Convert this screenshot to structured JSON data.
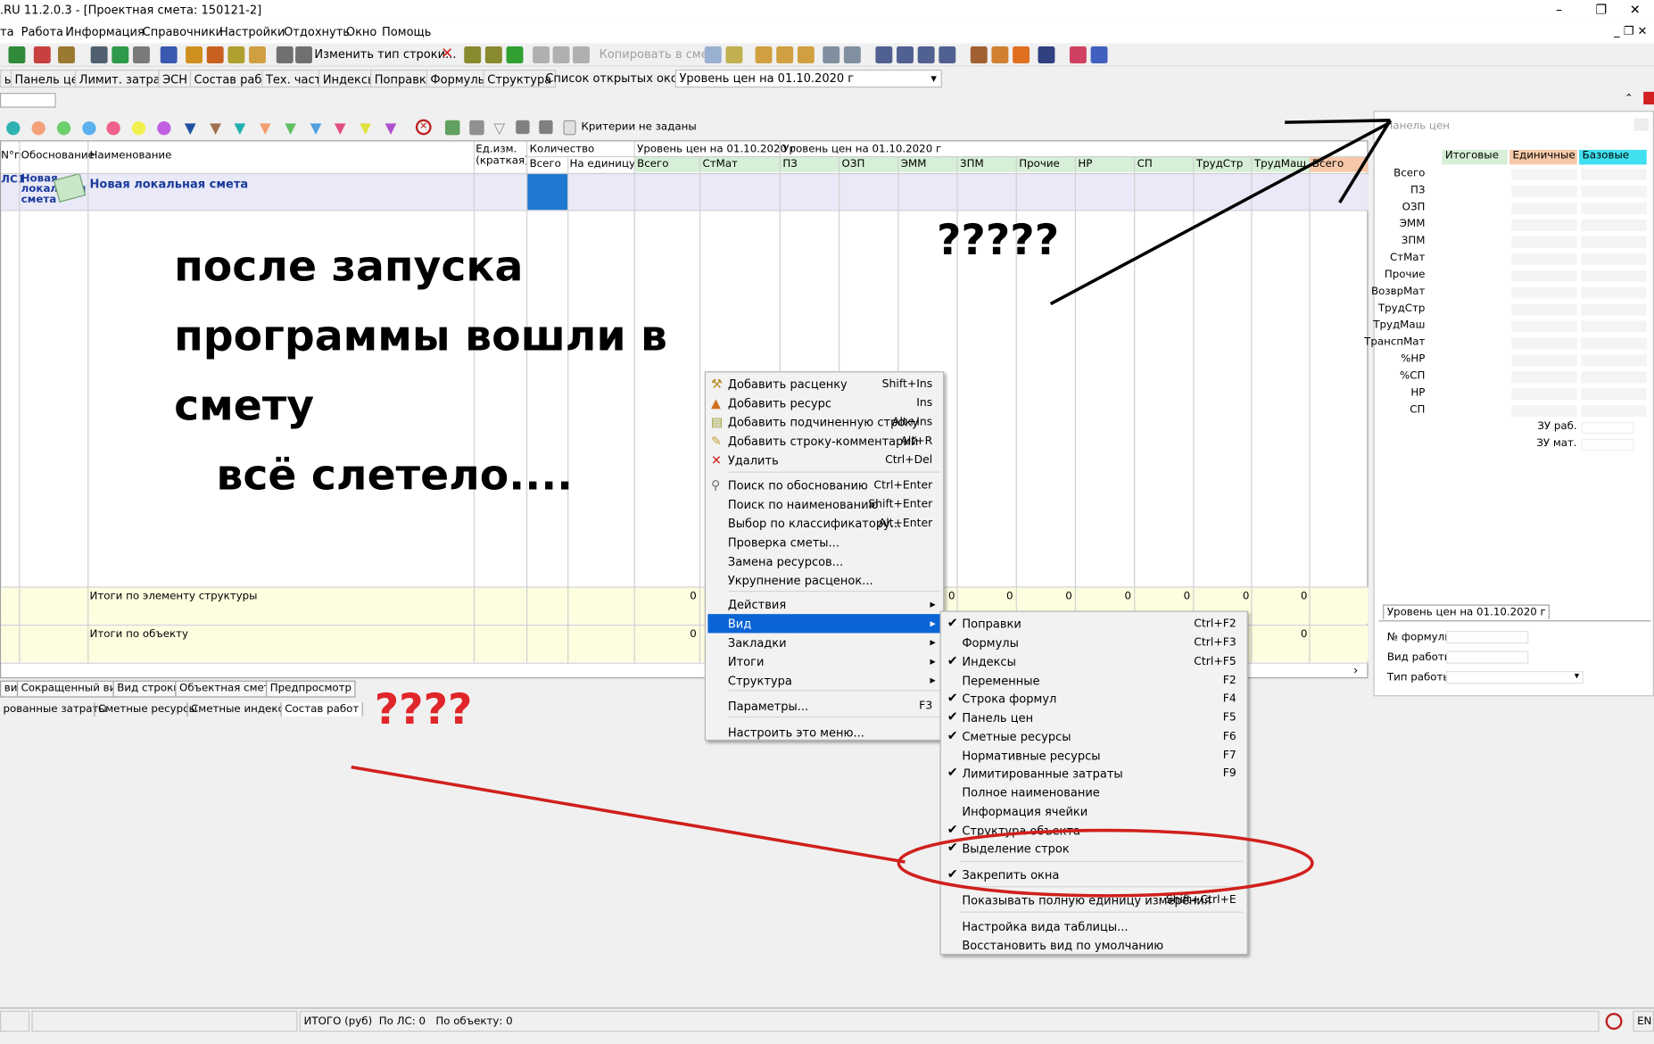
{
  "titlebar": {
    "text": ".RU  11.2.0.3  - [Проектная смета: 150121-2]"
  },
  "menu": [
    "та",
    "Работа",
    "Информация",
    "Справочники",
    "Настройки",
    "Отдохнуть",
    "Окно",
    "Помощь"
  ],
  "toolbar": {
    "change_type": "Изменить тип строки...",
    "copy_to_estimate": "Копировать в смету"
  },
  "tabs": [
    "ы",
    "Панель цен",
    "Лимит. затраты",
    "ЭСН",
    "Состав работ",
    "Тех. часть",
    "Индексы",
    "Поправки",
    "Формулы",
    "Структура"
  ],
  "windows_list": {
    "label": "Список открытых окон",
    "price_level": "Уровень цен на 01.10.2020 г"
  },
  "filter": {
    "criteria": "Критерии не заданы"
  },
  "grid": {
    "headers": {
      "num": "N°п",
      "basis": "Обоснование",
      "name": "Наименование",
      "unit": "Ед.изм. (краткая)",
      "qty": "Количество",
      "qty_total": "Всего",
      "qty_per": "На единицу",
      "price_level_a": "Уровень цен на 01.10.2020 г",
      "price_level_b": "Уровень цен на 01.10.2020 г",
      "cols": [
        "Всего",
        "СтМат",
        "ПЗ",
        "ОЗП",
        "ЭММ",
        "ЗПМ",
        "Прочие",
        "НР",
        "СП",
        "ТрудСтр",
        "ТрудМаш",
        "Всего"
      ]
    },
    "row1": {
      "num": "ЛС1",
      "basis": "Новая локальная смета",
      "name": "Новая локальная смета"
    },
    "totals_element": "Итоги по элементу структуры",
    "totals_object": "Итоги по объекту",
    "zero": "0"
  },
  "overlay": {
    "line1": "после запуска",
    "line2": "программы вошли в",
    "line3": "смету",
    "line4": "всё слетело....",
    "q_right": "?????",
    "q_bottom": "????"
  },
  "bottom_tabs": [
    "вид",
    "Сокращенный вид",
    "Вид строки",
    "Объектная смета",
    "Предпросмотр"
  ],
  "bottom_tabs2": [
    "рованные затраты",
    "Сметные ресурсы",
    "Сметные индексы",
    "Состав работ"
  ],
  "right_panel": {
    "title": "Панель цен",
    "headers": [
      "Итоговые",
      "Единичные",
      "Базовые"
    ],
    "rows": [
      "Всего",
      "ПЗ",
      "ОЗП",
      "ЭММ",
      "ЗПМ",
      "СтМат",
      "Прочие",
      "ВозврМат",
      "ТрудСтр",
      "ТрудМаш",
      "ТранспМат",
      "%НР",
      "%СП",
      "НР",
      "СП"
    ],
    "zu_rab": "ЗУ раб.",
    "zu_mat": "ЗУ мат.",
    "tab": "Уровень цен на 01.10.2020 г",
    "fields": [
      "№ формулы",
      "Вид работы",
      "Тип работы"
    ]
  },
  "context_menu": [
    {
      "label": "Добавить расценку",
      "shortcut": "Shift+Ins",
      "icon": "add-rate-icon"
    },
    {
      "label": "Добавить ресурс",
      "shortcut": "Ins",
      "icon": "add-resource-icon"
    },
    {
      "label": "Добавить подчиненную строку",
      "shortcut": "Alt+Ins",
      "icon": "add-subrow-icon"
    },
    {
      "label": "Добавить строку-комментарий",
      "shortcut": "Alt+R",
      "icon": "add-comment-icon"
    },
    {
      "label": "Удалить",
      "shortcut": "Ctrl+Del",
      "icon": "delete-icon"
    },
    {
      "label": "Поиск по обоснованию",
      "shortcut": "Ctrl+Enter",
      "icon": "search-icon"
    },
    {
      "label": "Поиск по наименованию",
      "shortcut": "Shift+Enter"
    },
    {
      "label": "Выбор по классификатору...",
      "shortcut": "Alt+Enter"
    },
    {
      "label": "Проверка сметы..."
    },
    {
      "label": "Замена ресурсов..."
    },
    {
      "label": "Укрупнение расценок..."
    },
    {
      "label": "Действия"
    },
    {
      "label": "Вид"
    },
    {
      "label": "Закладки"
    },
    {
      "label": "Итоги"
    },
    {
      "label": "Структура"
    },
    {
      "label": "Параметры...",
      "shortcut": "F3"
    },
    {
      "label": "Настроить это меню..."
    }
  ],
  "view_menu": [
    {
      "label": "Поправки",
      "shortcut": "Ctrl+F2",
      "checked": true
    },
    {
      "label": "Формулы",
      "shortcut": "Ctrl+F3",
      "checked": false
    },
    {
      "label": "Индексы",
      "shortcut": "Ctrl+F5",
      "checked": true
    },
    {
      "label": "Переменные",
      "shortcut": "F2",
      "checked": false
    },
    {
      "label": "Строка формул",
      "shortcut": "F4",
      "checked": true
    },
    {
      "label": "Панель цен",
      "shortcut": "F5",
      "checked": true
    },
    {
      "label": "Сметные ресурсы",
      "shortcut": "F6",
      "checked": true
    },
    {
      "label": "Нормативные ресурсы",
      "shortcut": "F7",
      "checked": false
    },
    {
      "label": "Лимитированные затраты",
      "shortcut": "F9",
      "checked": true
    },
    {
      "label": "Полное наименование",
      "shortcut": "",
      "checked": false
    },
    {
      "label": "Информация ячейки",
      "shortcut": "",
      "checked": false
    },
    {
      "label": "Структура объекта",
      "shortcut": "",
      "checked": true
    },
    {
      "label": "Выделение строк",
      "shortcut": "",
      "checked": true
    },
    {
      "label": "Закрепить окна",
      "shortcut": "",
      "checked": true
    },
    {
      "label": "Показывать полную единицу измерения",
      "shortcut": "Shift+Ctrl+E",
      "checked": false
    },
    {
      "label": "Настройка вида таблицы...",
      "shortcut": "",
      "checked": false
    },
    {
      "label": "Восстановить вид по умолчанию",
      "shortcut": "",
      "checked": false
    }
  ],
  "status": {
    "total": "ИТОГО (руб)",
    "by_ls": "По ЛС: 0",
    "by_obj": "По объекту: 0",
    "lang": "EN"
  },
  "colors": {
    "accent": "#0a64d6",
    "selection": "#1f78d1",
    "red_annot": "#e0262a"
  }
}
